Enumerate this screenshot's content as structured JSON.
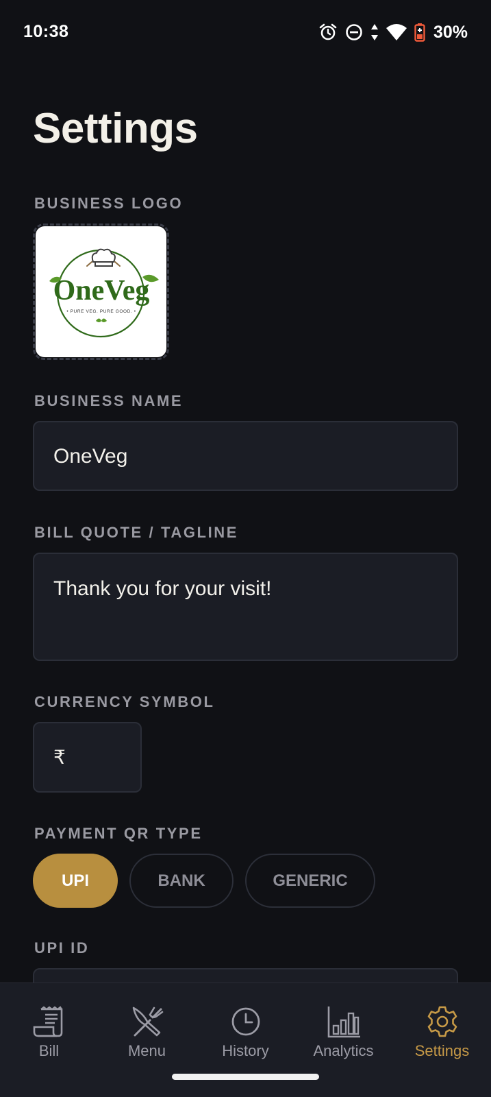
{
  "status_bar": {
    "time": "10:38",
    "battery": "30%",
    "icons": [
      "alarm-icon",
      "do-not-disturb-icon",
      "data-arrows-icon",
      "wifi-icon",
      "battery-icon"
    ]
  },
  "page": {
    "title": "Settings"
  },
  "logo": {
    "label": "BUSINESS LOGO",
    "brand_text": "OneVeg",
    "brand_tagline": "• PURE VEG. PURE GOOD. •"
  },
  "business_name": {
    "label": "BUSINESS NAME",
    "value": "OneVeg"
  },
  "tagline": {
    "label": "BILL QUOTE / TAGLINE",
    "value": "Thank you for your visit!"
  },
  "currency": {
    "label": "CURRENCY SYMBOL",
    "value": "₹"
  },
  "payment_qr": {
    "label": "PAYMENT QR TYPE",
    "options": [
      "UPI",
      "BANK",
      "GENERIC"
    ],
    "selected": "UPI"
  },
  "upi": {
    "label": "UPI ID",
    "value": ""
  },
  "nav": {
    "items": [
      {
        "label": "Bill",
        "icon": "receipt-icon"
      },
      {
        "label": "Menu",
        "icon": "utensils-icon"
      },
      {
        "label": "History",
        "icon": "clock-icon"
      },
      {
        "label": "Analytics",
        "icon": "bar-chart-icon"
      },
      {
        "label": "Settings",
        "icon": "gear-icon"
      }
    ],
    "active": "Settings"
  },
  "colors": {
    "background": "#101115",
    "surface": "#1b1d25",
    "accent": "#b88f3f",
    "accent_text": "#c79a47",
    "muted_text": "#9a9aa2",
    "brand_green": "#2f6a1a"
  }
}
